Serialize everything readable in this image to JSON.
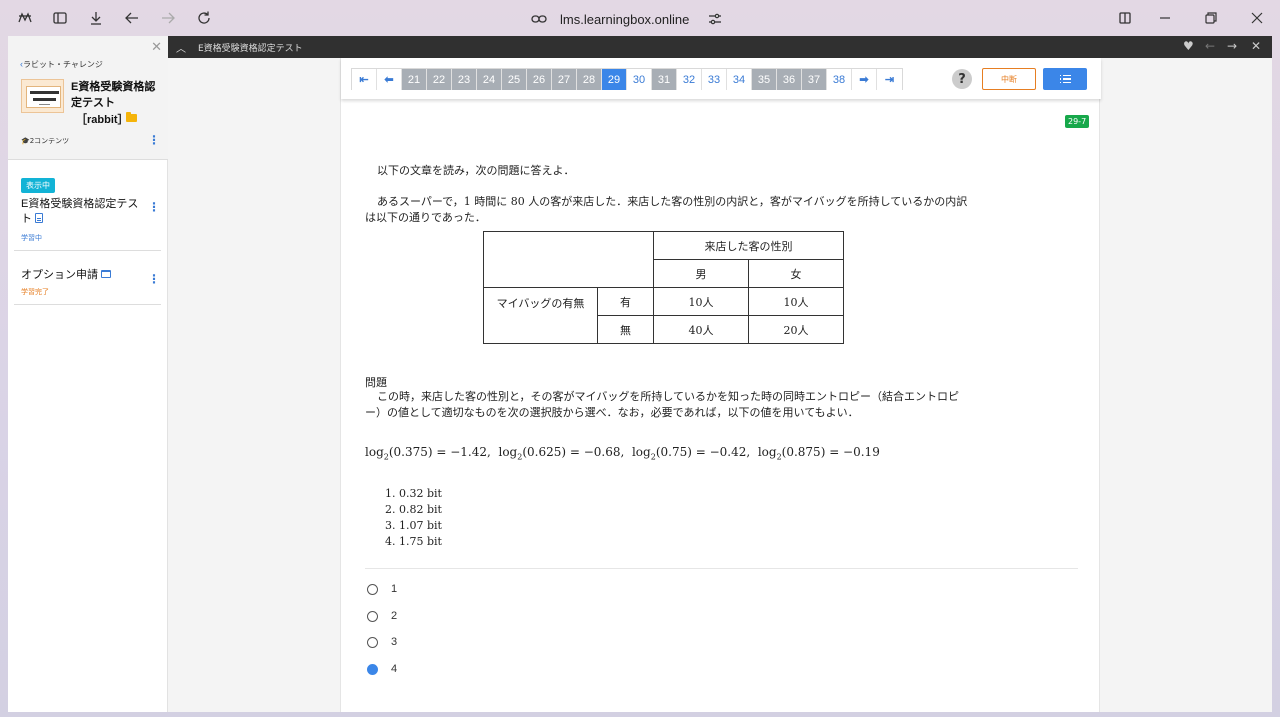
{
  "browser": {
    "url": "lms.learningbox.online"
  },
  "sidebar": {
    "back_label": "ラビット・チャレンジ",
    "course_title": "E資格受験資格認定テスト",
    "course_tag": "［rabbit］",
    "content_count": "2コンテンツ",
    "items": [
      {
        "badge": "表示中",
        "name": "E資格受験資格認定テスト",
        "status": "学習中"
      },
      {
        "name": "オプション申請",
        "status": "学習完了"
      }
    ]
  },
  "topbar": {
    "title": "E資格受験資格認定テスト"
  },
  "pager": {
    "pages": [
      "21",
      "22",
      "23",
      "24",
      "25",
      "26",
      "27",
      "28",
      "29",
      "30",
      "31",
      "32",
      "33",
      "34",
      "35",
      "36",
      "37",
      "38"
    ],
    "states": [
      "done",
      "done",
      "done",
      "done",
      "done",
      "done",
      "done",
      "done",
      "cur",
      "todo",
      "done",
      "todo",
      "todo",
      "todo",
      "done",
      "done",
      "done",
      "todo"
    ]
  },
  "controls": {
    "help": "?",
    "pause": "中断"
  },
  "question": {
    "id_badge": "29-7",
    "intro": "以下の文章を読み，次の問題に答えよ．",
    "body": "あるスーパーで，1 時間に 80 人の客が来店した．来店した客の性別の内訳と，客がマイバッグを所持しているかの内訳は以下の通りであった．",
    "table": {
      "header_top": "来店した客の性別",
      "col_male": "男",
      "col_female": "女",
      "row_group": "マイバッグの有無",
      "row_yes": "有",
      "row_no": "無",
      "yes_male": "10人",
      "yes_female": "10人",
      "no_male": "40人",
      "no_female": "20人"
    },
    "heading": "問題",
    "text": "この時，来店した客の性別と，その客がマイバッグを所持しているかを知った時の同時エントロピー（結合エントロピー）の値として適切なものを次の選択肢から選べ．なお，必要であれば，以下の値を用いてもよい．",
    "formula": {
      "f1_arg": "(0.375) = −1.42,",
      "f2_arg": "(0.625) = −0.68,",
      "f3_arg": "(0.75) = −0.42,",
      "f4_arg": "(0.875) = −0.19",
      "log": "log",
      "base": "2"
    },
    "options": [
      "1.  0.32 bit",
      "2.  0.82 bit",
      "3.  1.07 bit",
      "4.  1.75 bit"
    ],
    "answers": [
      "1",
      "2",
      "3",
      "4"
    ],
    "selected_answer": "4"
  },
  "colors": {
    "accent": "#3b86e8",
    "done_page": "#a8aeb5",
    "badge_now": "#12b3d6",
    "id_badge": "#17a84b",
    "pause": "#e67e22"
  }
}
